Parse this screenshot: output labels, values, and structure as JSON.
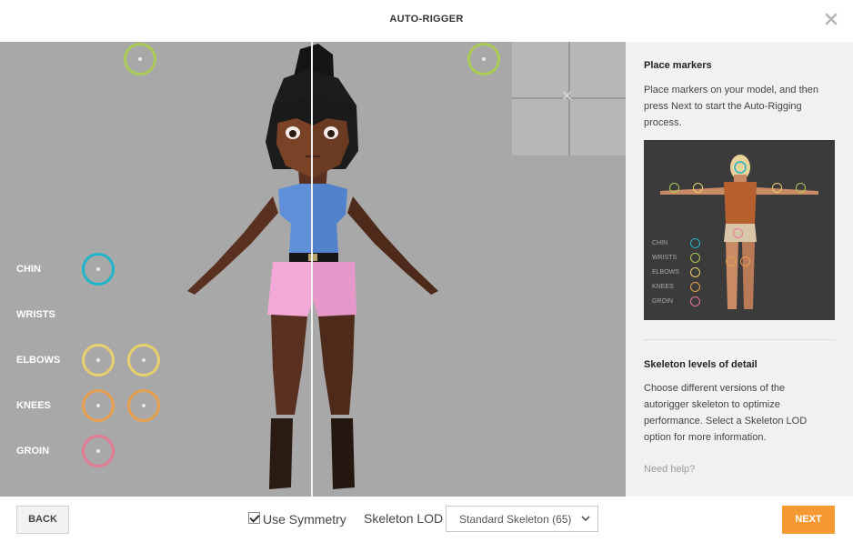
{
  "app": {
    "title": "AUTO-RIGGER"
  },
  "viewport": {
    "markers": [
      {
        "label": "CHIN",
        "color": "#20b5c8"
      },
      {
        "label": "WRISTS",
        "color": "#a9cc55"
      },
      {
        "label": "ELBOWS",
        "color": "#e8d06a"
      },
      {
        "label": "KNEES",
        "color": "#e8a04e"
      },
      {
        "label": "GROIN",
        "color": "#e47a93"
      }
    ],
    "placed_marker_color": "#a9cc55"
  },
  "panel": {
    "place_title": "Place markers",
    "place_text": "Place markers on your model, and then press Next to start the Auto-Rigging process.",
    "thumb_labels": [
      "CHIN",
      "WRISTS",
      "ELBOWS",
      "KNEES",
      "GROIN"
    ],
    "lod_title": "Skeleton levels of detail",
    "lod_text": "Choose different versions of the autorigger skeleton to optimize performance. Select a Skeleton LOD option for more information.",
    "help": "Need help?"
  },
  "footer": {
    "back": "BACK",
    "symmetry_label": "Use Symmetry",
    "symmetry_checked": true,
    "lod_label": "Skeleton LOD",
    "lod_value": "Standard Skeleton (65)",
    "next": "NEXT"
  },
  "colors": {
    "accent": "#f59a33"
  }
}
